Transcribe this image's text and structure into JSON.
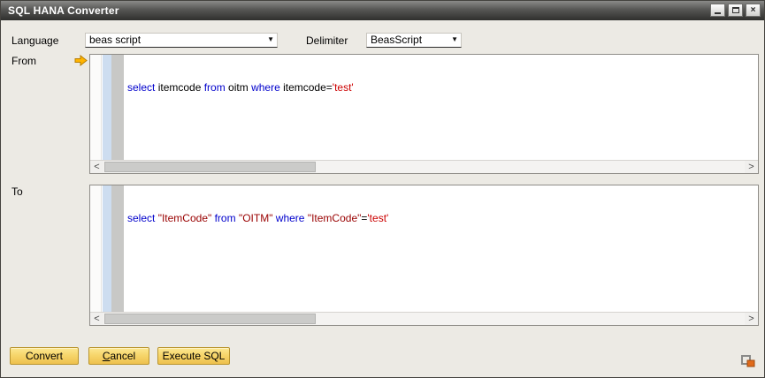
{
  "window": {
    "title": "SQL HANA Converter"
  },
  "icons": {
    "combo_arrow": "▼",
    "scroll_left": "<",
    "scroll_right": ">"
  },
  "form": {
    "language_label": "Language",
    "language_value": "beas script",
    "delimiter_label": "Delimiter",
    "delimiter_value": "BeasScript"
  },
  "from_section": {
    "label": "From",
    "code_tokens": [
      {
        "text": "select",
        "type": "keyword"
      },
      {
        "text": " itemcode ",
        "type": "plain"
      },
      {
        "text": "from",
        "type": "keyword"
      },
      {
        "text": " oitm ",
        "type": "plain"
      },
      {
        "text": "where",
        "type": "keyword"
      },
      {
        "text": " itemcode",
        "type": "plain"
      },
      {
        "text": "=",
        "type": "plain"
      },
      {
        "text": "'test'",
        "type": "string"
      }
    ]
  },
  "to_section": {
    "label": "To",
    "code_tokens": [
      {
        "text": "select",
        "type": "keyword"
      },
      {
        "text": " ",
        "type": "plain"
      },
      {
        "text": "\"ItemCode\"",
        "type": "quoted"
      },
      {
        "text": " ",
        "type": "plain"
      },
      {
        "text": "from",
        "type": "keyword"
      },
      {
        "text": " ",
        "type": "plain"
      },
      {
        "text": "\"OITM\"",
        "type": "quoted"
      },
      {
        "text": " ",
        "type": "plain"
      },
      {
        "text": "where",
        "type": "keyword"
      },
      {
        "text": " ",
        "type": "plain"
      },
      {
        "text": "\"ItemCode\"",
        "type": "quoted"
      },
      {
        "text": "=",
        "type": "plain"
      },
      {
        "text": "'test'",
        "type": "string"
      }
    ]
  },
  "buttons": [
    {
      "label": "Convert"
    },
    {
      "label": "Cancel",
      "mnemonic": 0
    },
    {
      "label": "Execute SQL"
    }
  ],
  "colors": {
    "keyword": "#0000cc",
    "string": "#cc0000",
    "quoted_identifier": "#990000",
    "button_face": "#f6d468",
    "titlebar_dark": "#2f2f2d"
  }
}
